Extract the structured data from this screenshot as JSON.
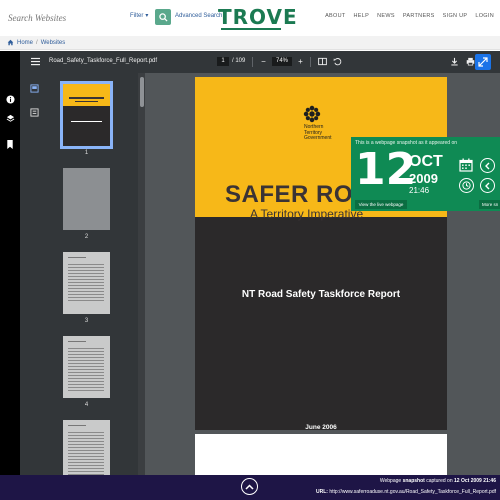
{
  "header": {
    "search_placeholder": "Search Websites",
    "filter_label": "Filter",
    "advanced_search_label": "Advanced Search",
    "logo_text": "TROVE",
    "nav": [
      "ABOUT",
      "HELP",
      "NEWS",
      "PARTNERS",
      "SIGN UP",
      "LOGIN"
    ]
  },
  "breadcrumb": {
    "home": "Home",
    "separator": "/",
    "current": "Websites"
  },
  "viewer": {
    "file_name": "Road_Safety_Taskforce_Full_Report.pdf",
    "page_current": "1",
    "page_total": "/ 109",
    "zoom": "74%",
    "thumbnails": [
      {
        "label": "1",
        "selected": true
      },
      {
        "label": "2",
        "selected": false
      },
      {
        "label": "3",
        "selected": false
      },
      {
        "label": "4",
        "selected": false
      }
    ],
    "colors": {
      "toolbar": "#323639",
      "canvas": "#525659",
      "active": "#1a73e8"
    }
  },
  "document": {
    "org_line1": "Northern",
    "org_line2": "Territory",
    "org_line3": "Government",
    "title": "SAFER ROAD USE:",
    "subtitle": "A Territory Imperative",
    "report_title": "NT Road Safety Taskforce Report",
    "date": "June 2006",
    "colors": {
      "cover_yellow": "#f7b818",
      "cover_dark": "#2b292a"
    }
  },
  "snapshot": {
    "intro": "This is a webpage snapshot as it appeared on",
    "day": "12",
    "month": "OCT",
    "year": "2009",
    "time": "21:46",
    "live_button": "View the live webpage",
    "more_button": "More sn",
    "color": "#0f8a54"
  },
  "footer": {
    "caption_prefix": "Webpage",
    "caption_bold": "snapshot",
    "caption_mid": "captured on",
    "caption_date": "12 Oct 2009 21:46",
    "url_label": "URL:",
    "url": "http://www.saferroaduse.nt.gov.au/Road_Safety_Taskforce_Full_Report.pdf"
  }
}
